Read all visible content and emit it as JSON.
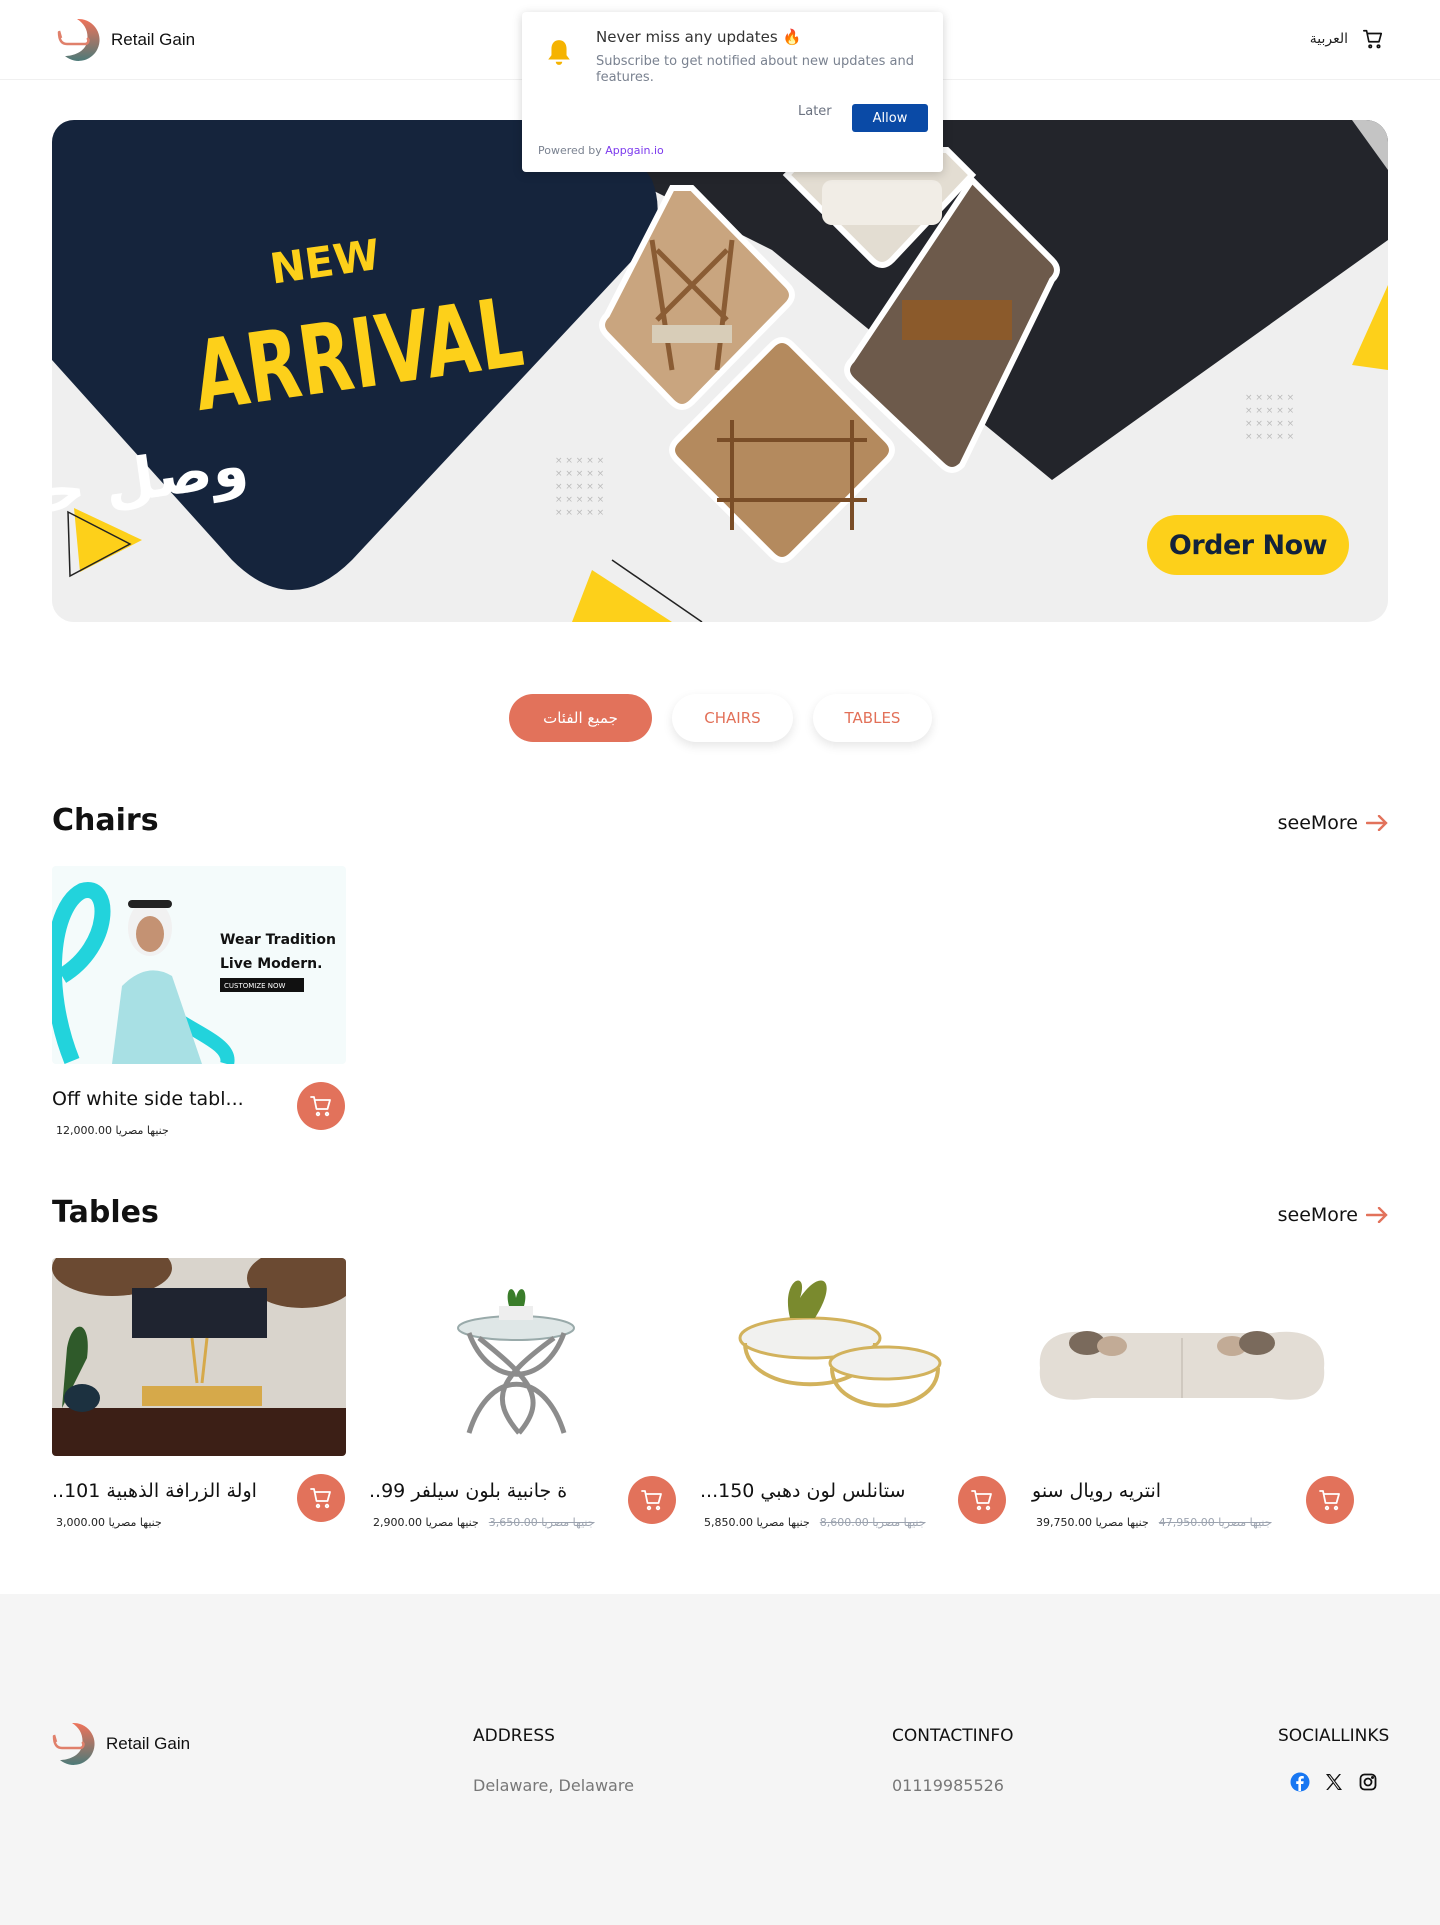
{
  "header": {
    "brand": "Retail Gain",
    "language_link": "العربية",
    "cart_icon": "cart-icon"
  },
  "notification": {
    "icon": "bell-icon",
    "title": "Never miss any updates 🔥",
    "body": "Subscribe to get notified about new updates and features.",
    "later_label": "Later",
    "allow_label": "Allow",
    "powered_prefix": "Powered by",
    "powered_link": "Appgain.io"
  },
  "banner": {
    "kicker": "NEW",
    "headline": "ARRIVAL",
    "arabic_headline": "وصل حديثاً",
    "cta_label": "Order Now",
    "colors": {
      "navy": "#15243c",
      "yellow": "#fdd01a"
    }
  },
  "categories": {
    "tabs": [
      {
        "label": "جميع الفئات",
        "active": true
      },
      {
        "label": "CHAIRS",
        "active": false
      },
      {
        "label": "TABLES",
        "active": false
      }
    ]
  },
  "sections": {
    "chairs": {
      "title": "Chairs",
      "see_more": "seeMore",
      "products": [
        {
          "name": "Off white side tabl...",
          "price": "12,000.00 جنيها مصريا",
          "old_price": null,
          "image_text": {
            "line1": "Wear Tradition",
            "line2": "Live Modern.",
            "cta": "CUSTOMIZE NOW"
          }
        }
      ]
    },
    "tables": {
      "title": "Tables",
      "see_more": "seeMore",
      "products": [
        {
          "name": "..اولة الزرافة الذهبية 101",
          "price": "3,000.00 جنيها مصريا",
          "old_price": null
        },
        {
          "name": "..ة جانبية بلون سيلفر 99",
          "price": "2,900.00 جنيها مصريا",
          "old_price": "3,650.00 جنيها مصريا"
        },
        {
          "name": "...ستانلس لون دهبي 150",
          "price": "5,850.00 جنيها مصريا",
          "old_price": "8,600.00 جنيها مصريا"
        },
        {
          "name": "انتريه رويال سنو",
          "price": "39,750.00 جنيها مصريا",
          "old_price": "47,950.00 جنيها مصريا"
        }
      ]
    }
  },
  "footer": {
    "brand": "Retail Gain",
    "address_heading": "ADDRESS",
    "address_value": "Delaware, Delaware",
    "contact_heading": "CONTACTINFO",
    "contact_value": "01119985526",
    "social_heading": "SOCIALLINKS",
    "social_links": [
      "facebook-icon",
      "x-icon",
      "instagram-icon"
    ]
  },
  "colors": {
    "accent": "#e2725b",
    "allow_button": "#0a4aa6",
    "powered_link": "#7c3aed",
    "footer_bg": "#f5f5f5",
    "facebook": "#1877f2"
  }
}
